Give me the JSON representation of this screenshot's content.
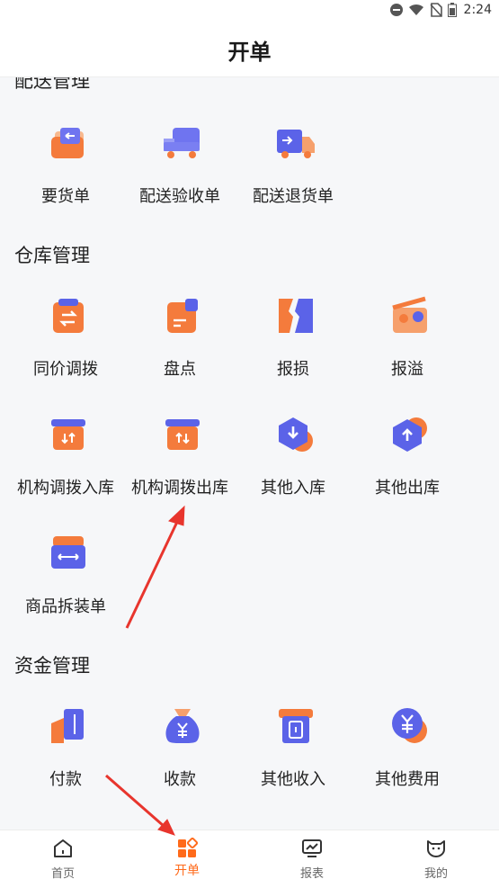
{
  "status_bar": {
    "time": "2:24"
  },
  "header": {
    "title": "开单"
  },
  "sections": {
    "top": {
      "title": "配送管理",
      "items": [
        "要货单",
        "配送验收单",
        "配送退货单"
      ]
    },
    "warehouse": {
      "title": "仓库管理",
      "items": [
        "同价调拨",
        "盘点",
        "报损",
        "报溢",
        "机构调拨入库",
        "机构调拨出库",
        "其他入库",
        "其他出库",
        "商品拆装单"
      ]
    },
    "finance": {
      "title": "资金管理",
      "items": [
        "付款",
        "收款",
        "其他收入",
        "其他费用"
      ]
    }
  },
  "bottom_nav": {
    "items": [
      "首页",
      "开单",
      "报表",
      "我的"
    ],
    "active_index": 1
  },
  "colors": {
    "accent": "#ff6a1a",
    "purple": "#5b63e8",
    "orange": "#f47b3c",
    "annotation_red": "#e8352d"
  }
}
